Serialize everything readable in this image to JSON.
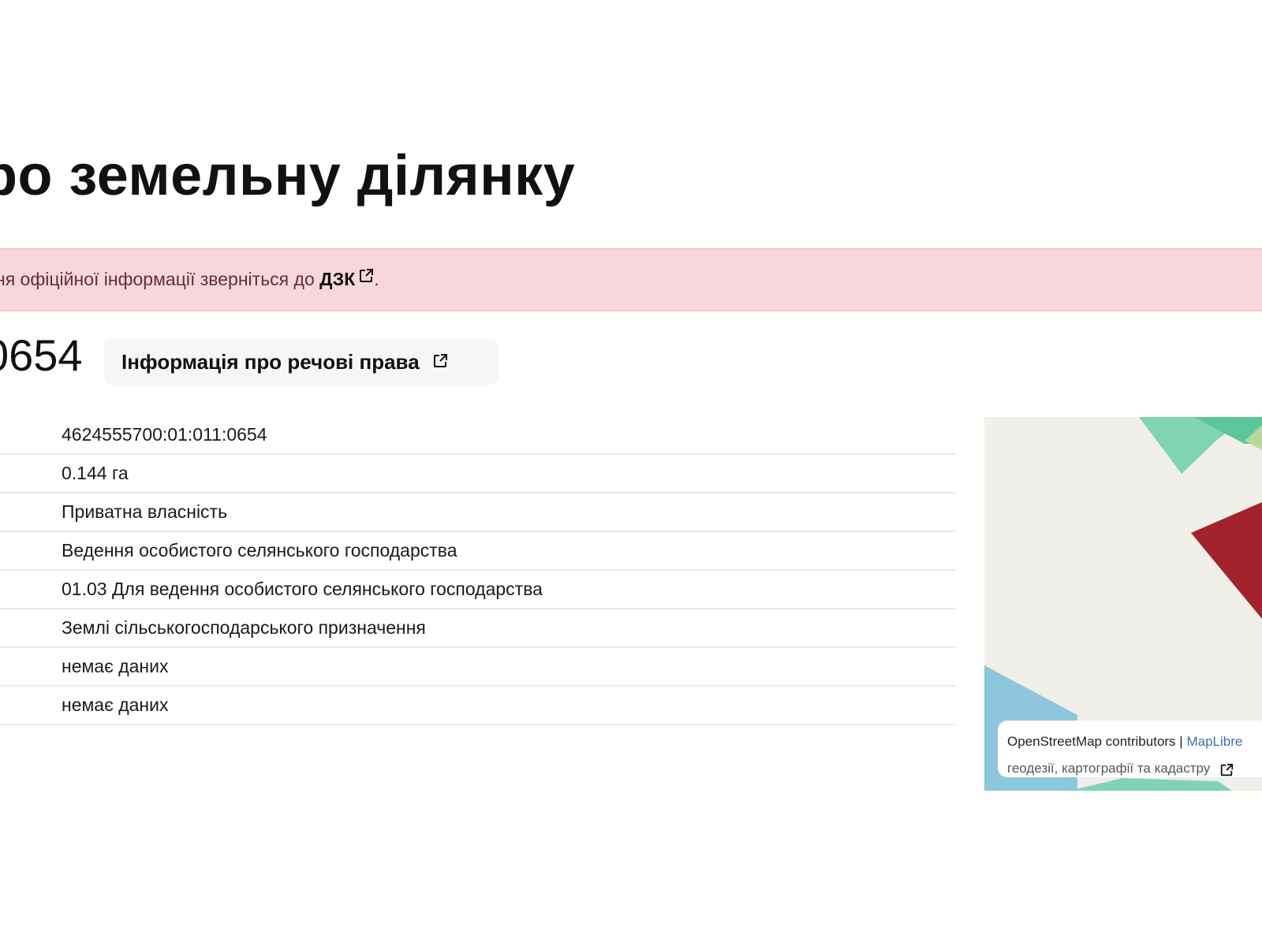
{
  "header": {
    "title": "ро земельну ділянку"
  },
  "alert": {
    "text": "ня офіційної інформації зверніться до",
    "link_label": "ДЗК",
    "trailing": "."
  },
  "parcel": {
    "heading": "0654",
    "rights_button_label": "Інформація про речові права"
  },
  "info_rows": [
    {
      "value": "4624555700:01:011:0654"
    },
    {
      "value": "0.144 га"
    },
    {
      "value": "Приватна власність"
    },
    {
      "value": "Ведення особистого селянського господарства"
    },
    {
      "value": "01.03 Для ведення особистого селянського господарства"
    },
    {
      "value": "Землі сільськогосподарського призначення"
    },
    {
      "value": "немає даних"
    },
    {
      "value": "немає даних"
    }
  ],
  "map": {
    "attribution_osm": "OpenStreetMap contributors",
    "attribution_separator": "|",
    "attribution_maplibre": "MapLibre",
    "attribution_second_line": "геодезії, картографії та кадастру",
    "colors": {
      "background": "#f1efe9",
      "parcel_highlight": "#a3232c",
      "green_area": "#7fd4b4",
      "dark_green_area": "#5cc79a",
      "light_green_area": "#b7d89a",
      "water_area": "#8ec6dc"
    }
  },
  "icons": {
    "external_link": "external-link-icon"
  }
}
